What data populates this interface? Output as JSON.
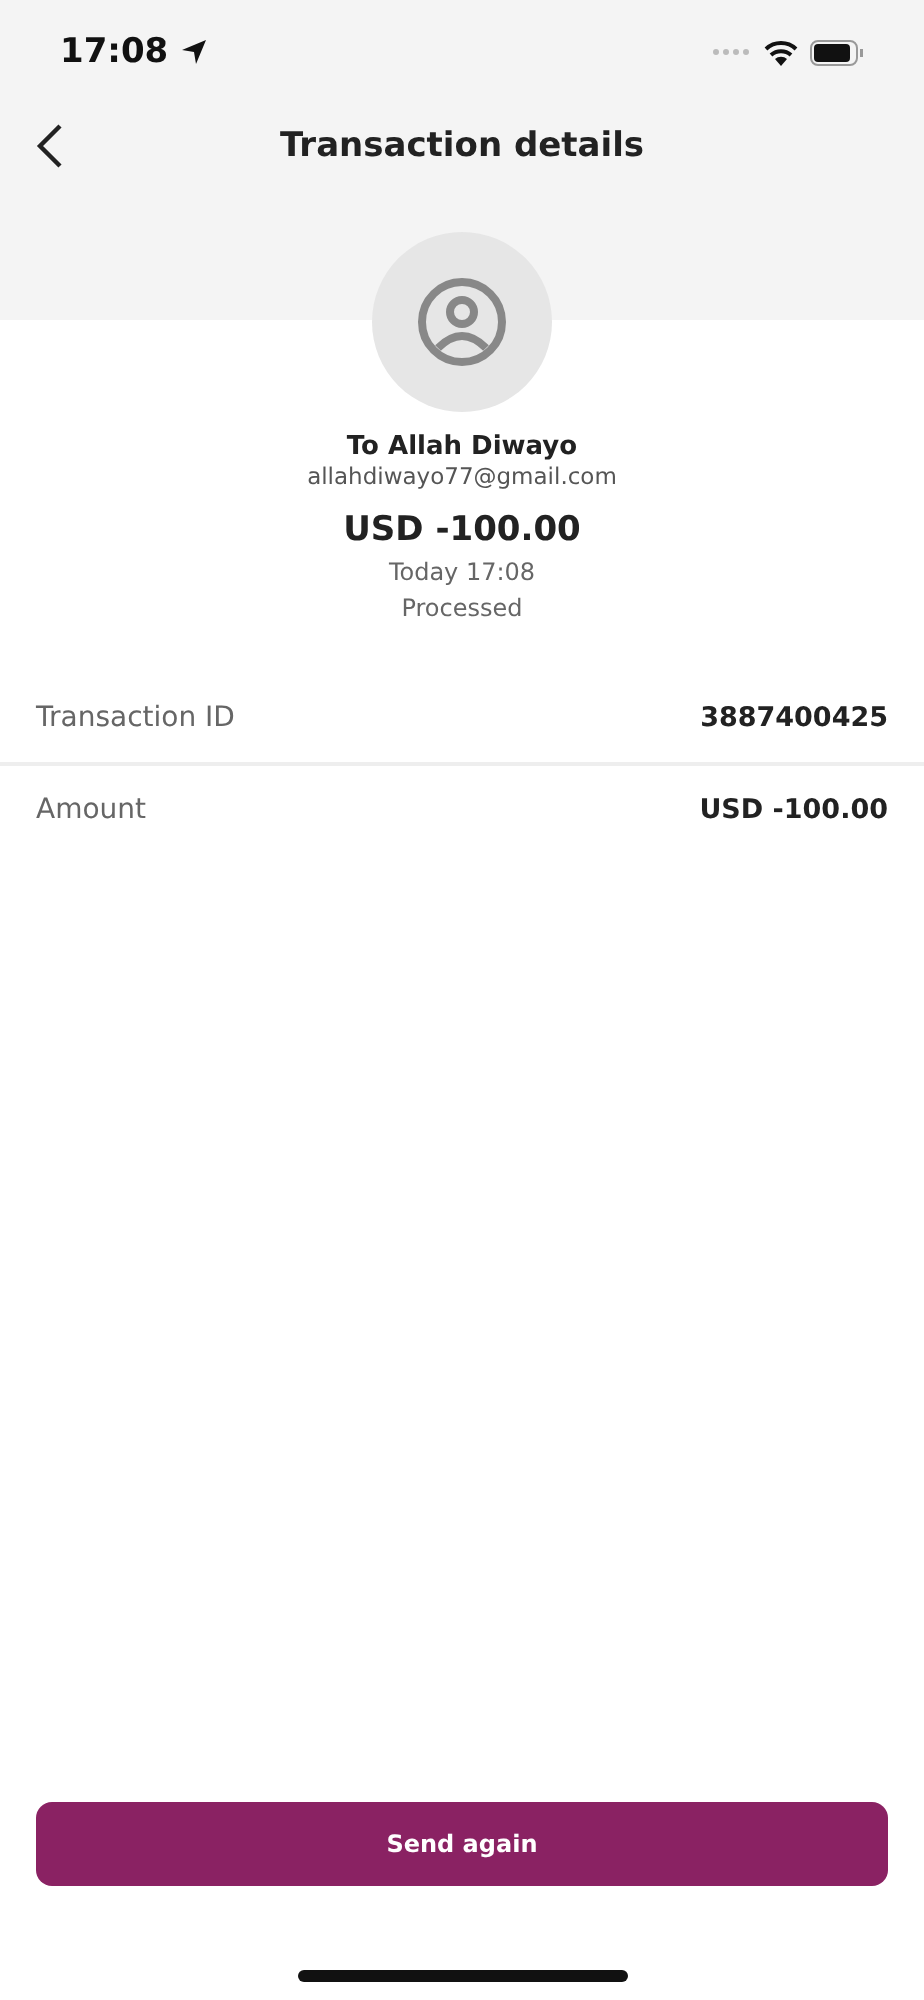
{
  "status_bar": {
    "time": "17:08"
  },
  "header": {
    "title": "Transaction details"
  },
  "recipient": {
    "name": "To Allah Diwayo",
    "email": "allahdiwayo77@gmail.com"
  },
  "amount": "USD -100.00",
  "date": "Today 17:08",
  "status": "Processed",
  "details": [
    {
      "label": "Transaction ID",
      "value": "3887400425"
    },
    {
      "label": "Amount",
      "value": "USD -100.00"
    }
  ],
  "button": "Send again"
}
